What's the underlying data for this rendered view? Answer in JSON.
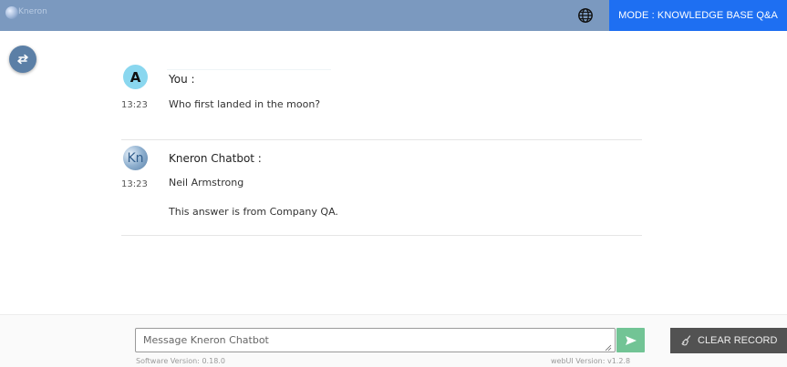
{
  "header": {
    "logo_text": "Kneron",
    "mode_label": "MODE : KNOWLEDGE BASE Q&A",
    "globe_icon": "globe-icon",
    "accent_color": "#1e6ff2",
    "bar_color": "#7b99bf"
  },
  "sidebar": {
    "swap_icon": "swap-arrows-icon"
  },
  "messages": [
    {
      "avatar_letter": "A",
      "sender": "You :",
      "time": "13:23",
      "lines": [
        "Who first landed in the moon?"
      ]
    },
    {
      "avatar_letter": "Kn",
      "sender": "Kneron Chatbot :",
      "time": "13:23",
      "lines": [
        "Neil Armstrong",
        "This answer is from Company QA."
      ]
    }
  ],
  "footer": {
    "input_placeholder": "Message Kneron Chatbot",
    "input_value": "",
    "send_icon": "send-arrow-icon",
    "clear_label": "CLEAR RECORD",
    "clear_icon": "broom-icon",
    "software_version": "Software Version: 0.18.0",
    "webui_version": "webUI Version: v1.2.8"
  }
}
